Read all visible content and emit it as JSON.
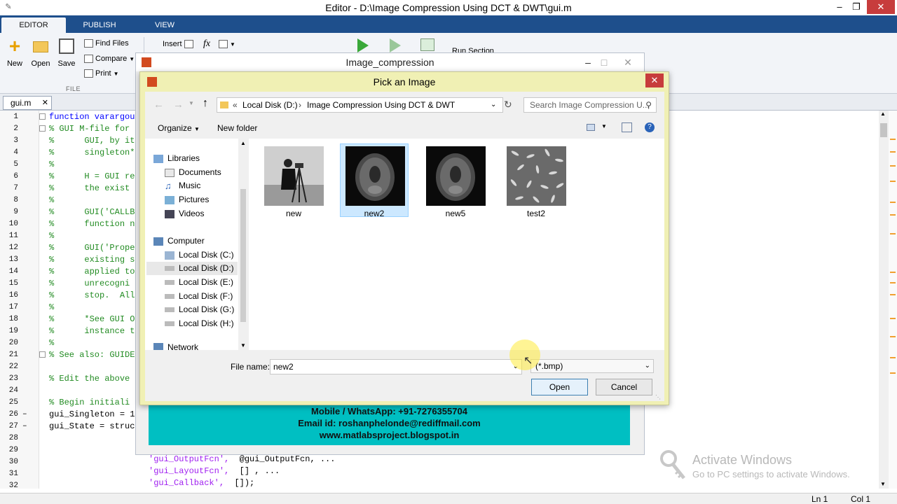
{
  "window": {
    "title": "Editor - D:\\Image Compression Using DCT &  DWT\\gui.m"
  },
  "ribbon": {
    "tabs": [
      "EDITOR",
      "PUBLISH",
      "VIEW"
    ],
    "buttons": {
      "new": "New",
      "open": "Open",
      "save": "Save",
      "find_files": "Find Files",
      "compare": "Compare",
      "print": "Print",
      "insert": "Insert",
      "fx": "fx",
      "run_section": "Run Section"
    },
    "group_file": "FILE"
  },
  "editor": {
    "tab": "gui.m",
    "lines": [
      {
        "n": "1",
        "text": "function varargou",
        "cls": "kw"
      },
      {
        "n": "2",
        "text": "% GUI M-file for",
        "cls": "cm"
      },
      {
        "n": "3",
        "text": "%      GUI, by it",
        "cls": "cm"
      },
      {
        "n": "4",
        "text": "%      singleton*",
        "cls": "cm"
      },
      {
        "n": "5",
        "text": "%",
        "cls": "cm"
      },
      {
        "n": "6",
        "text": "%      H = GUI re",
        "cls": "cm"
      },
      {
        "n": "7",
        "text": "%      the exist",
        "cls": "cm"
      },
      {
        "n": "8",
        "text": "%",
        "cls": "cm"
      },
      {
        "n": "9",
        "text": "%      GUI('CALLB",
        "cls": "cm"
      },
      {
        "n": "10",
        "text": "%      function n",
        "cls": "cm"
      },
      {
        "n": "11",
        "text": "%",
        "cls": "cm"
      },
      {
        "n": "12",
        "text": "%      GUI('Prope",
        "cls": "cm"
      },
      {
        "n": "13",
        "text": "%      existing s",
        "cls": "cm"
      },
      {
        "n": "14",
        "text": "%      applied to",
        "cls": "cm"
      },
      {
        "n": "15",
        "text": "%      unrecogni",
        "cls": "cm"
      },
      {
        "n": "16",
        "text": "%      stop.  All",
        "cls": "cm"
      },
      {
        "n": "17",
        "text": "%",
        "cls": "cm"
      },
      {
        "n": "18",
        "text": "%      *See GUI O",
        "cls": "cm"
      },
      {
        "n": "19",
        "text": "%      instance t",
        "cls": "cm"
      },
      {
        "n": "20",
        "text": "%",
        "cls": "cm"
      },
      {
        "n": "21",
        "text": "% See also: GUIDE",
        "cls": "cm"
      },
      {
        "n": "22",
        "text": "",
        "cls": ""
      },
      {
        "n": "23",
        "text": "% Edit the above",
        "cls": "cm"
      },
      {
        "n": "24",
        "text": "",
        "cls": ""
      },
      {
        "n": "25",
        "text": "% Begin initiali",
        "cls": "cm"
      },
      {
        "n": "26",
        "text": "gui_Singleton = 1",
        "cls": ""
      },
      {
        "n": "27",
        "text": "gui_State = struc",
        "cls": ""
      },
      {
        "n": "28",
        "text": "",
        "cls": ""
      },
      {
        "n": "29",
        "text": "",
        "cls": ""
      },
      {
        "n": "30",
        "text": "",
        "cls": ""
      },
      {
        "n": "31",
        "text": "",
        "cls": ""
      },
      {
        "n": "32",
        "text": "",
        "cls": ""
      }
    ],
    "visible_tail": [
      {
        "a": "'gui_OutputFcn',",
        "b": "@gui_OutputFcn, ..."
      },
      {
        "a": "'gui_LayoutFcn',",
        "b": "[] , ..."
      },
      {
        "a": "'gui_Callback',",
        "b": "[]);"
      }
    ]
  },
  "figure": {
    "title": "Image_compression",
    "contact": [
      "Mobile / WhatsApp: +91-7276355704",
      "Email id: roshanphelonde@rediffmail.com",
      "www.matlabsproject.blogspot.in"
    ]
  },
  "dialog": {
    "title": "Pick an Image",
    "breadcrumb": [
      "Local Disk (D:)",
      "Image Compression Using DCT &  DWT"
    ],
    "search_placeholder": "Search Image Compression U...",
    "organize": "Organize",
    "new_folder": "New folder",
    "nav": {
      "libraries": "Libraries",
      "library_items": [
        "Documents",
        "Music",
        "Pictures",
        "Videos"
      ],
      "computer": "Computer",
      "drives": [
        "Local Disk (C:)",
        "Local Disk (D:)",
        "Local Disk (E:)",
        "Local Disk (F:)",
        "Local Disk (G:)",
        "Local Disk (H:)"
      ],
      "selected_drive": "Local Disk (D:)",
      "network": "Network"
    },
    "files": [
      {
        "name": "new",
        "kind": "cameraman"
      },
      {
        "name": "new2",
        "kind": "mri",
        "selected": true
      },
      {
        "name": "new5",
        "kind": "mri"
      },
      {
        "name": "test2",
        "kind": "rice"
      }
    ],
    "file_name_label": "File name:",
    "file_name_value": "new2",
    "file_type": "(*.bmp)",
    "open": "Open",
    "cancel": "Cancel"
  },
  "status": {
    "ln": "Ln  1",
    "col": "Col  1"
  },
  "watermark": {
    "line1": "Activate Windows",
    "line2": "Go to PC settings to activate Windows."
  }
}
